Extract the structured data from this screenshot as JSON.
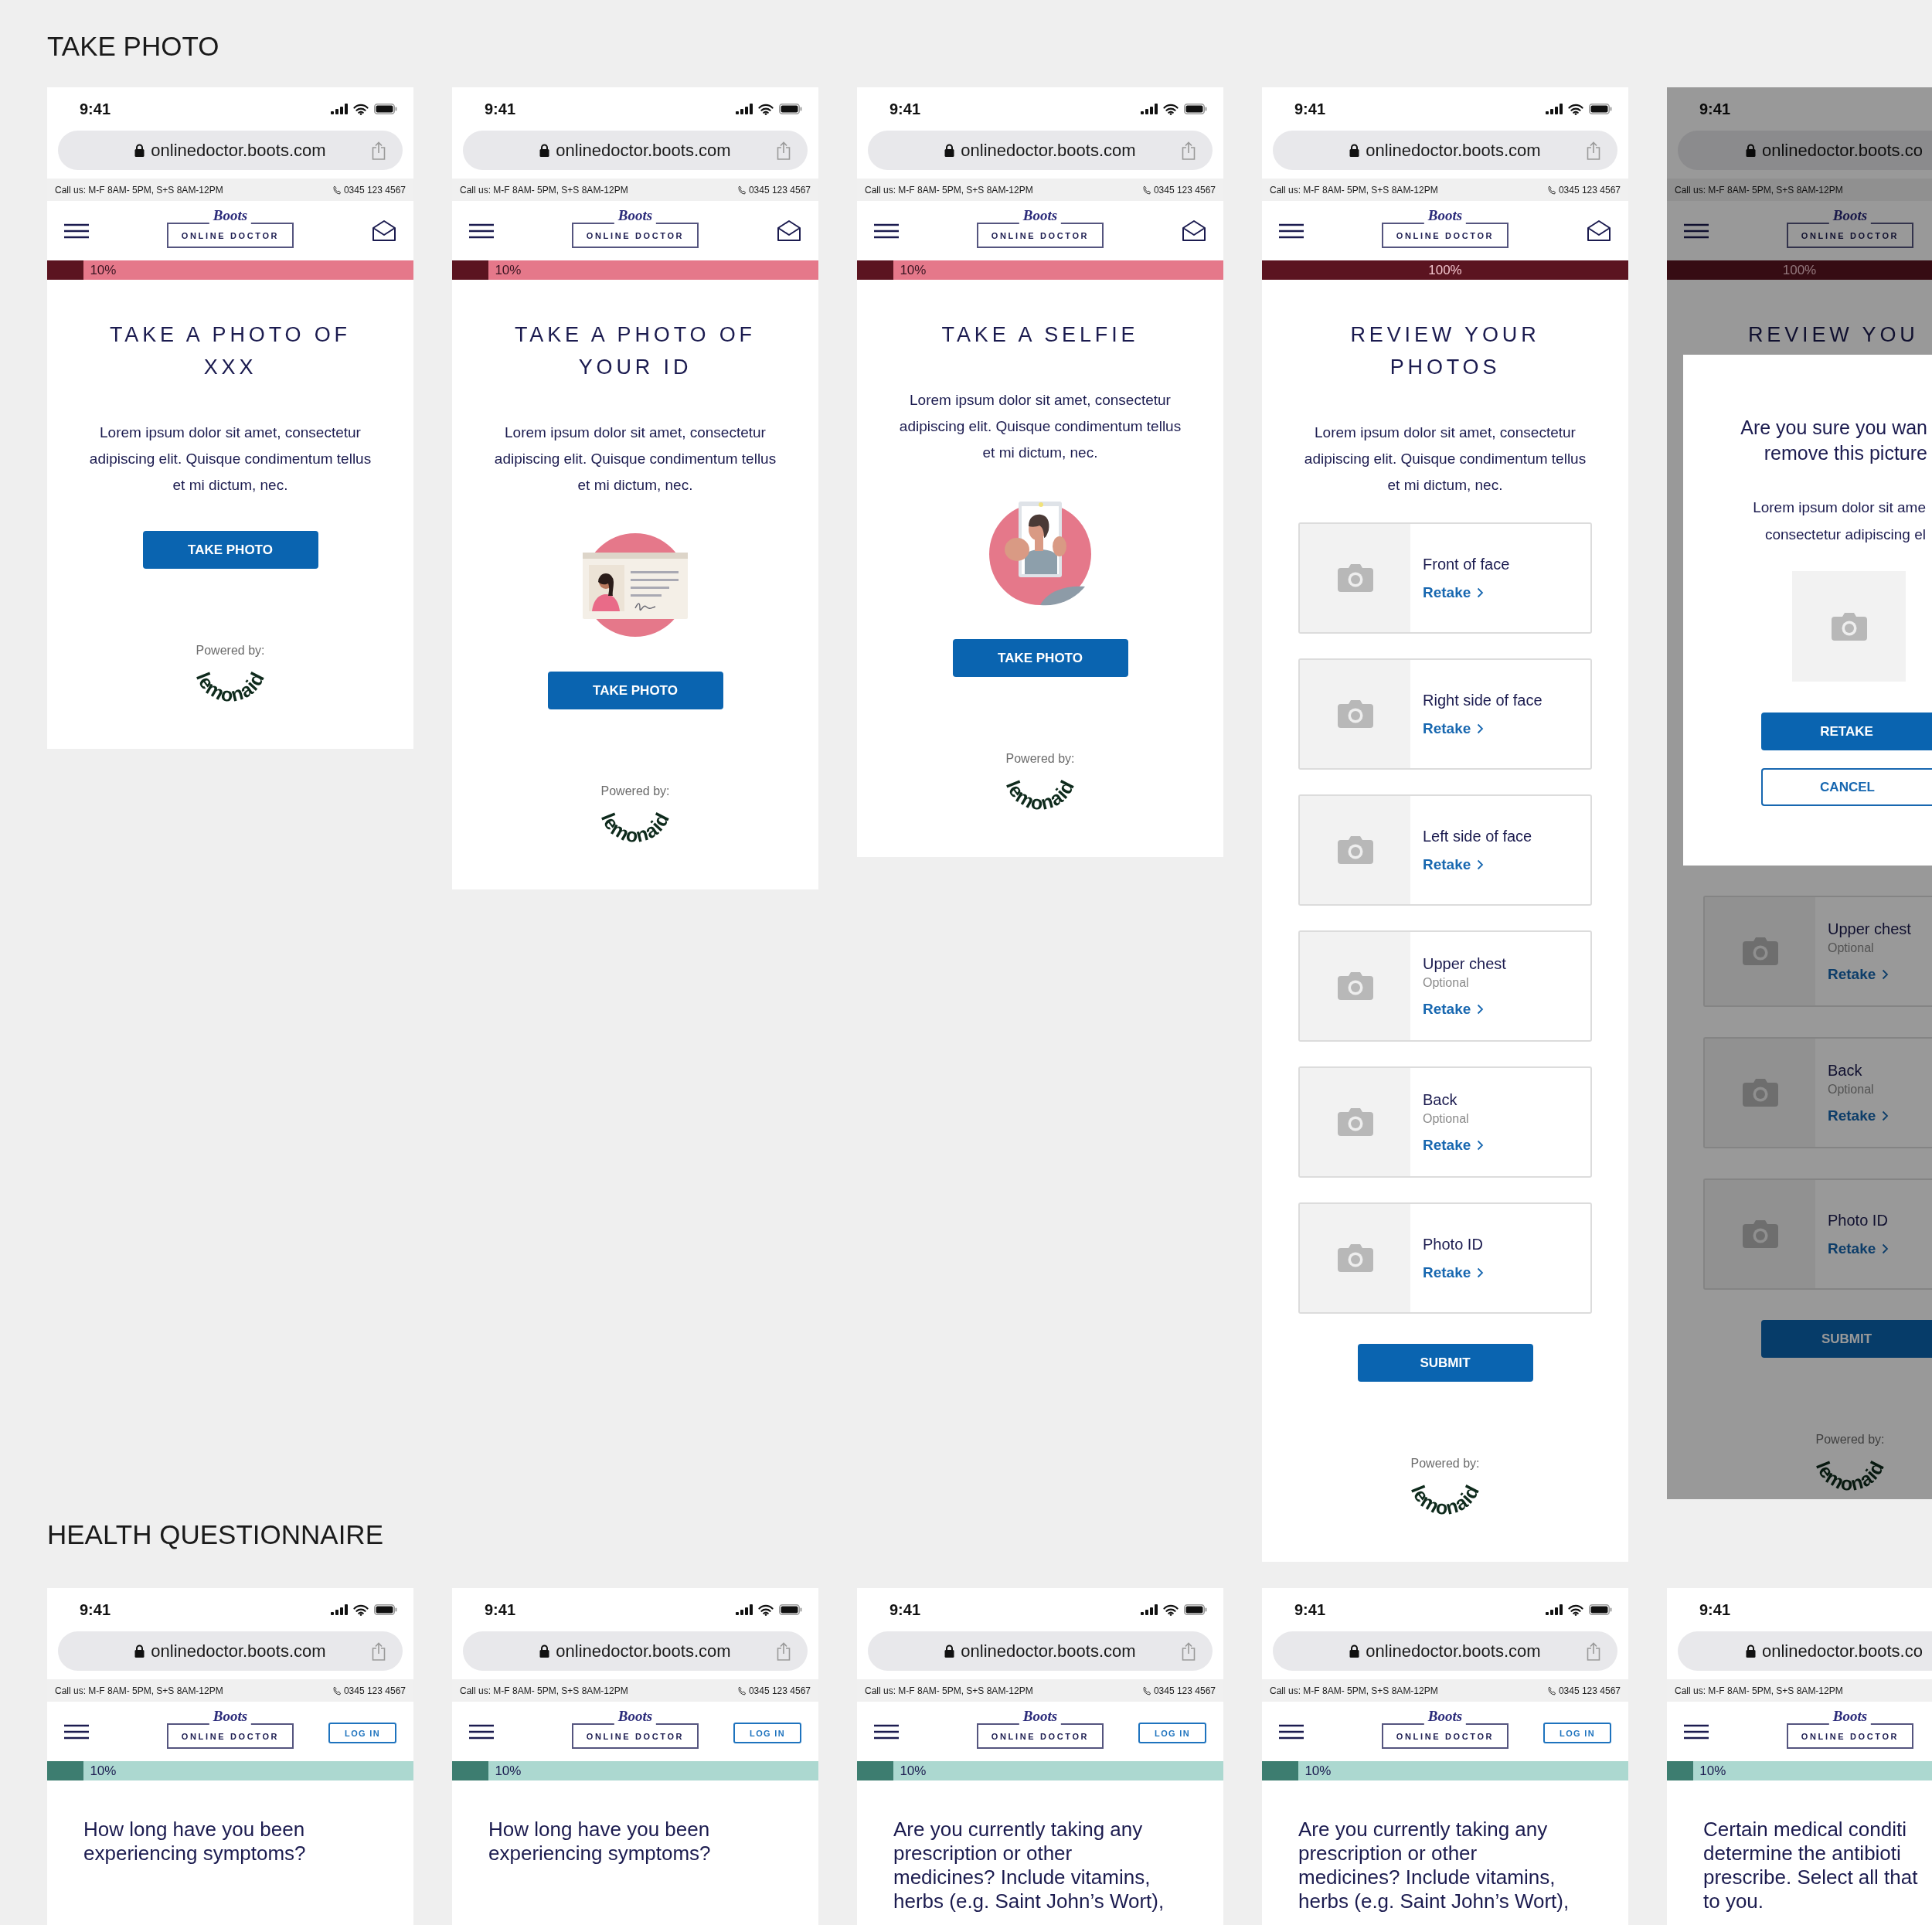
{
  "sections": [
    {
      "kind": "photo",
      "title": "TAKE PHOTO",
      "phones": [
        {
          "time": "9:41",
          "url": "onlinedoctor.boots.com",
          "hours": "Call us: M-F 8AM- 5PM, S+S 8AM-12PM",
          "phone": "0345 123 4567",
          "brand": "Boots",
          "logo": "ONLINE DOCTOR",
          "action": {
            "kind": "mail"
          },
          "progress": {
            "level": 0.1,
            "label": "10%"
          },
          "screen": {
            "kind": "intro",
            "title": "TAKE A PHOTO OF XXX",
            "body": "Lorem ipsum dolor sit amet, consectetur adipiscing elit. Quisque condimentum tellus et mi dictum, nec.",
            "button": "TAKE PHOTO",
            "powered_by": "Powered by:",
            "partner": "lemonaid"
          }
        },
        {
          "time": "9:41",
          "url": "onlinedoctor.boots.com",
          "hours": "Call us: M-F 8AM- 5PM, S+S 8AM-12PM",
          "phone": "0345 123 4567",
          "brand": "Boots",
          "logo": "ONLINE DOCTOR",
          "action": {
            "kind": "mail"
          },
          "progress": {
            "level": 0.1,
            "label": "10%"
          },
          "screen": {
            "kind": "intro",
            "title": "TAKE A PHOTO OF YOUR ID",
            "body": "Lorem ipsum dolor sit amet, consectetur adipiscing elit. Quisque condimentum tellus et mi dictum, nec.",
            "illustration": {
              "kind": "id_card"
            },
            "button": "TAKE PHOTO",
            "powered_by": "Powered by:",
            "partner": "lemonaid"
          }
        },
        {
          "time": "9:41",
          "url": "onlinedoctor.boots.com",
          "hours": "Call us: M-F 8AM- 5PM, S+S 8AM-12PM",
          "phone": "0345 123 4567",
          "brand": "Boots",
          "logo": "ONLINE DOCTOR",
          "action": {
            "kind": "mail"
          },
          "progress": {
            "level": 0.1,
            "label": "10%"
          },
          "screen": {
            "kind": "intro",
            "title": "TAKE A SELFIE",
            "body": "Lorem ipsum dolor sit amet, consectetur adipiscing elit. Quisque condimentum tellus et mi dictum, nec.",
            "illustration": {
              "kind": "selfie"
            },
            "button": "TAKE PHOTO",
            "powered_by": "Powered by:",
            "partner": "lemonaid"
          }
        },
        {
          "time": "9:41",
          "url": "onlinedoctor.boots.com",
          "hours": "Call us: M-F 8AM- 5PM, S+S 8AM-12PM",
          "phone": "0345 123 4567",
          "brand": "Boots",
          "logo": "ONLINE DOCTOR",
          "action": {
            "kind": "mail"
          },
          "progress": {
            "level": 1,
            "label": "100%"
          },
          "screen": {
            "kind": "review",
            "title": "REVIEW YOUR PHOTOS",
            "body": "Lorem ipsum dolor sit amet, consectetur adipiscing elit. Quisque condimentum tellus et mi dictum, nec.",
            "photos": [
              {
                "label": "Front of face",
                "action": "Retake"
              },
              {
                "label": "Right side of face",
                "action": "Retake"
              },
              {
                "label": "Left side of face",
                "action": "Retake"
              },
              {
                "label": "Upper chest",
                "note": "Optional",
                "action": "Retake"
              },
              {
                "label": "Back",
                "note": "Optional",
                "action": "Retake"
              },
              {
                "label": "Photo ID",
                "action": "Retake"
              }
            ],
            "button": "SUBMIT",
            "powered_by": "Powered by:",
            "partner": "lemonaid"
          }
        },
        {
          "time": "9:41",
          "url": "onlinedoctor.boots.co",
          "hours": "Call us: M-F 8AM- 5PM, S+S 8AM-12PM",
          "brand": "Boots",
          "logo": "ONLINE DOCTOR",
          "progress": {
            "level": 1,
            "label": "100%"
          },
          "screen": {
            "kind": "review",
            "title": "REVIEW YOU",
            "photos": [
              {
                "label": "Upper chest",
                "note": "Optional",
                "action": "Retake"
              },
              {
                "label": "Back",
                "note": "Optional",
                "action": "Retake"
              },
              {
                "label": "Photo ID",
                "action": "Retake"
              }
            ],
            "button": "SUBMIT",
            "powered_by": "Powered by:",
            "partner": "lemonaid"
          },
          "dialog": {
            "title_lines": [
              "Are you sure you wan",
              "remove this picture"
            ],
            "text_lines": [
              "Lorem ipsum dolor sit ame",
              "consectetur adipiscing el"
            ],
            "buttons": [
              {
                "label": "RETAKE",
                "kind": "primary"
              },
              {
                "label": "CANCEL",
                "kind": "secondary"
              }
            ]
          }
        }
      ]
    },
    {
      "kind": "questionnaire",
      "title": "HEALTH QUESTIONNAIRE",
      "phones": [
        {
          "time": "9:41",
          "url": "onlinedoctor.boots.com",
          "hours": "Call us: M-F 8AM- 5PM, S+S 8AM-12PM",
          "phone": "0345 123 4567",
          "brand": "Boots",
          "logo": "ONLINE DOCTOR",
          "action": {
            "kind": "login",
            "label": "LOG IN"
          },
          "progress": {
            "level": 0.1,
            "label": "10%"
          },
          "screen": {
            "kind": "question",
            "lines": [
              "How long have you been",
              "experiencing symptoms?"
            ]
          }
        },
        {
          "time": "9:41",
          "url": "onlinedoctor.boots.com",
          "hours": "Call us: M-F 8AM- 5PM, S+S 8AM-12PM",
          "phone": "0345 123 4567",
          "brand": "Boots",
          "logo": "ONLINE DOCTOR",
          "action": {
            "kind": "login",
            "label": "LOG IN"
          },
          "progress": {
            "level": 0.1,
            "label": "10%"
          },
          "screen": {
            "kind": "question",
            "lines": [
              "How long have you been",
              "experiencing symptoms?"
            ]
          }
        },
        {
          "time": "9:41",
          "url": "onlinedoctor.boots.com",
          "hours": "Call us: M-F 8AM- 5PM, S+S 8AM-12PM",
          "phone": "0345 123 4567",
          "brand": "Boots",
          "logo": "ONLINE DOCTOR",
          "action": {
            "kind": "login",
            "label": "LOG IN"
          },
          "progress": {
            "level": 0.1,
            "label": "10%"
          },
          "screen": {
            "kind": "question",
            "lines": [
              "Are you currently taking any",
              "prescription or other",
              "medicines? Include vitamins,",
              "herbs (e.g. Saint John’s Wort),"
            ]
          }
        },
        {
          "time": "9:41",
          "url": "onlinedoctor.boots.com",
          "hours": "Call us: M-F 8AM- 5PM, S+S 8AM-12PM",
          "phone": "0345 123 4567",
          "brand": "Boots",
          "logo": "ONLINE DOCTOR",
          "action": {
            "kind": "login",
            "label": "LOG IN"
          },
          "progress": {
            "level": 0.1,
            "label": "10%"
          },
          "screen": {
            "kind": "question",
            "lines": [
              "Are you currently taking any",
              "prescription or other",
              "medicines? Include vitamins,",
              "herbs (e.g. Saint John’s Wort),"
            ]
          }
        },
        {
          "time": "9:41",
          "url": "onlinedoctor.boots.co",
          "hours": "Call us: M-F 8AM- 5PM, S+S 8AM-12PM",
          "brand": "Boots",
          "logo": "ONLINE DOCTOR",
          "progress": {
            "level": 0.1,
            "label": "10%"
          },
          "screen": {
            "kind": "question",
            "lines": [
              "Certain medical conditi",
              "determine the antibioti",
              "prescribe. Select all that",
              "to you."
            ]
          }
        }
      ]
    }
  ]
}
